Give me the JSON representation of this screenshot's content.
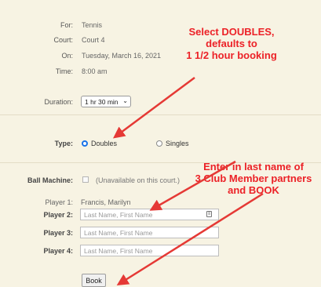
{
  "details": {
    "for_label": "For:",
    "for_value": "Tennis",
    "court_label": "Court:",
    "court_value": "Court 4",
    "on_label": "On:",
    "on_value": "Tuesday, March 16, 2021",
    "time_label": "Time:",
    "time_value": "8:00 am",
    "duration_label": "Duration:",
    "duration_value": "1 hr 30 min"
  },
  "type": {
    "label": "Type:",
    "options": [
      "Doubles",
      "Singles"
    ],
    "selected": "Doubles"
  },
  "ball_machine": {
    "label": "Ball Machine:",
    "note": "(Unavailable on this court.)",
    "checked": false
  },
  "players": {
    "p1_label": "Player 1:",
    "p1_value": "Francis, Marilyn",
    "p2_label": "Player 2:",
    "p3_label": "Player 3:",
    "p4_label": "Player 4:",
    "placeholder": "Last Name, First Name"
  },
  "book_label": "Book",
  "annotations": {
    "note1": [
      "Select DOUBLES,",
      "defaults to",
      "1 1/2 hour booking"
    ],
    "note2": [
      "Enter in last name of",
      "3 Club Member partners",
      "and BOOK"
    ],
    "color": "#ec2127"
  }
}
